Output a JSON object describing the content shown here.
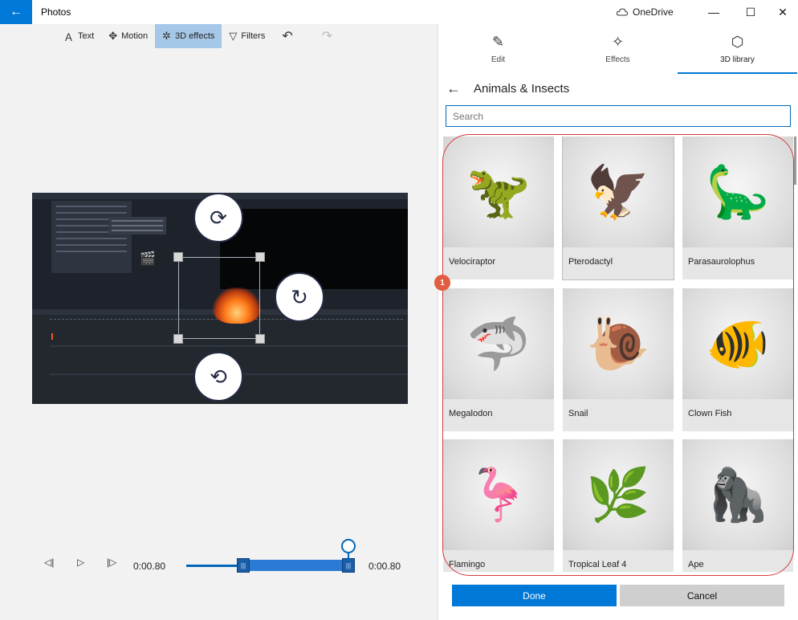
{
  "titlebar": {
    "back_glyph": "←",
    "app_title": "Photos",
    "onedrive_label": "OneDrive",
    "onedrive_icon": "cloud-icon",
    "minimize": "—",
    "maximize": "☐",
    "close": "✕"
  },
  "toolbar": {
    "items": [
      {
        "label": "Text",
        "icon": "text-icon",
        "glyph": "Ａ"
      },
      {
        "label": "Motion",
        "icon": "motion-icon",
        "glyph": "✥"
      },
      {
        "label": "3D effects",
        "icon": "3d-effects-icon",
        "glyph": "✲"
      },
      {
        "label": "Filters",
        "icon": "filters-icon",
        "glyph": "▽"
      }
    ],
    "undo_glyph": "↶",
    "redo_glyph": "↷",
    "active_item": "3D effects"
  },
  "playback": {
    "prev_frame_glyph": "◁|",
    "play_glyph": "▷",
    "next_frame_glyph": "|▷",
    "current_time": "0:00.80",
    "end_time": "0:00.80"
  },
  "panel": {
    "tabs": [
      {
        "label": "Edit",
        "icon": "pencil-icon",
        "glyph": "✎"
      },
      {
        "label": "Effects",
        "icon": "sparkle-icon",
        "glyph": "✧"
      },
      {
        "label": "3D library",
        "icon": "cube-icon",
        "glyph": "⬡"
      }
    ],
    "active_tab": "3D library",
    "back_glyph": "←",
    "category_title": "Animals & Insects",
    "search_placeholder": "Search",
    "items": [
      {
        "label": "Velociraptor",
        "glyph": "🦖"
      },
      {
        "label": "Pterodactyl",
        "glyph": "🦅"
      },
      {
        "label": "Parasaurolophus",
        "glyph": "🦕"
      },
      {
        "label": "Megalodon",
        "glyph": "🦈"
      },
      {
        "label": "Snail",
        "glyph": "🐌"
      },
      {
        "label": "Clown Fish",
        "glyph": "🐠"
      },
      {
        "label": "Flamingo",
        "glyph": "🦩"
      },
      {
        "label": "Tropical Leaf 4",
        "glyph": "🌿"
      },
      {
        "label": "Ape",
        "glyph": "🦍"
      }
    ],
    "done_label": "Done",
    "cancel_label": "Cancel"
  },
  "annotation": {
    "badge": "1"
  },
  "colors": {
    "accent": "#0078d7",
    "toolbar_active": "#a6c8e8",
    "annotation": "#d43a3f"
  }
}
